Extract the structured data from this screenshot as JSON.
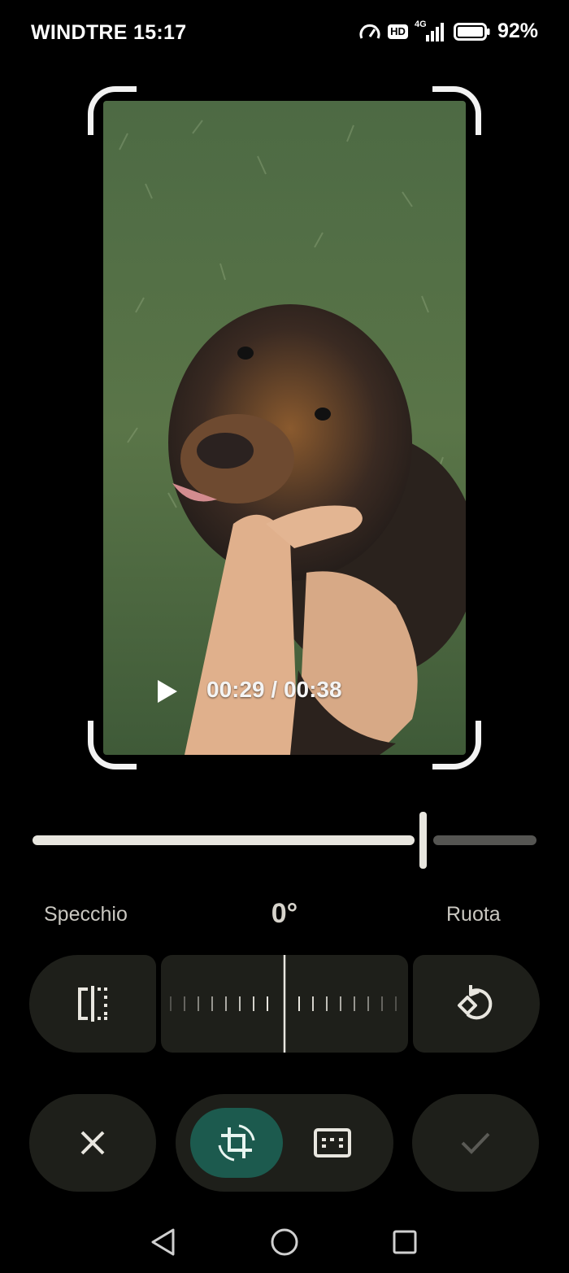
{
  "status_bar": {
    "carrier_time": "WINDTRE 15:17",
    "hd": "HD",
    "network": "4G",
    "battery": "92%",
    "battery_level": 0.92
  },
  "video": {
    "time": "00:29 / 00:38",
    "progress": 0.76
  },
  "labels": {
    "mirror": "Specchio",
    "angle": "0°",
    "rotate": "Ruota"
  },
  "icons": {
    "play": "play-icon",
    "mirror": "flip-horizontal-icon",
    "rotate": "rotate-left-icon",
    "cancel": "close-icon",
    "crop": "crop-rotate-icon",
    "aspect": "aspect-ratio-icon",
    "confirm": "check-icon"
  },
  "colors": {
    "active_tool": "#1c5a4e",
    "control_bg": "#1e1f1a",
    "track": "#e8e6df"
  }
}
